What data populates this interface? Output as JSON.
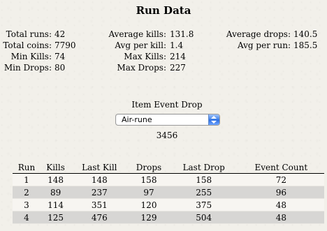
{
  "title": "Run Data",
  "stats": {
    "col1": [
      {
        "label": "Total runs:",
        "value": "42"
      },
      {
        "label": "Total coins:",
        "value": "7790"
      },
      {
        "label": "Min Kills:",
        "value": "74"
      },
      {
        "label": "Min Drops:",
        "value": "80"
      }
    ],
    "col2": [
      {
        "label": "Average kills:",
        "value": "131.8"
      },
      {
        "label": "Avg per kill:",
        "value": "1.4"
      },
      {
        "label": "Max Kills:",
        "value": "214"
      },
      {
        "label": "Max Drops:",
        "value": "227"
      }
    ],
    "col3": [
      {
        "label": "Average drops:",
        "value": "140.5"
      },
      {
        "label": "Avg per run:",
        "value": "185.5"
      }
    ]
  },
  "event": {
    "label": "Item Event Drop",
    "selected": "Air-rune",
    "count": "3456"
  },
  "table": {
    "headers": [
      "Run",
      "Kills",
      "Last Kill",
      "Drops",
      "Last Drop",
      "Event Count"
    ],
    "rows": [
      [
        "1",
        "148",
        "148",
        "158",
        "158",
        "72"
      ],
      [
        "2",
        "89",
        "237",
        "97",
        "255",
        "96"
      ],
      [
        "3",
        "114",
        "351",
        "120",
        "375",
        "48"
      ],
      [
        "4",
        "125",
        "476",
        "129",
        "504",
        "48"
      ]
    ]
  },
  "colors": {
    "background": "#f2f0ea",
    "row_alt": "#d7d6d4",
    "select_arrow": "#3d7fe8"
  }
}
